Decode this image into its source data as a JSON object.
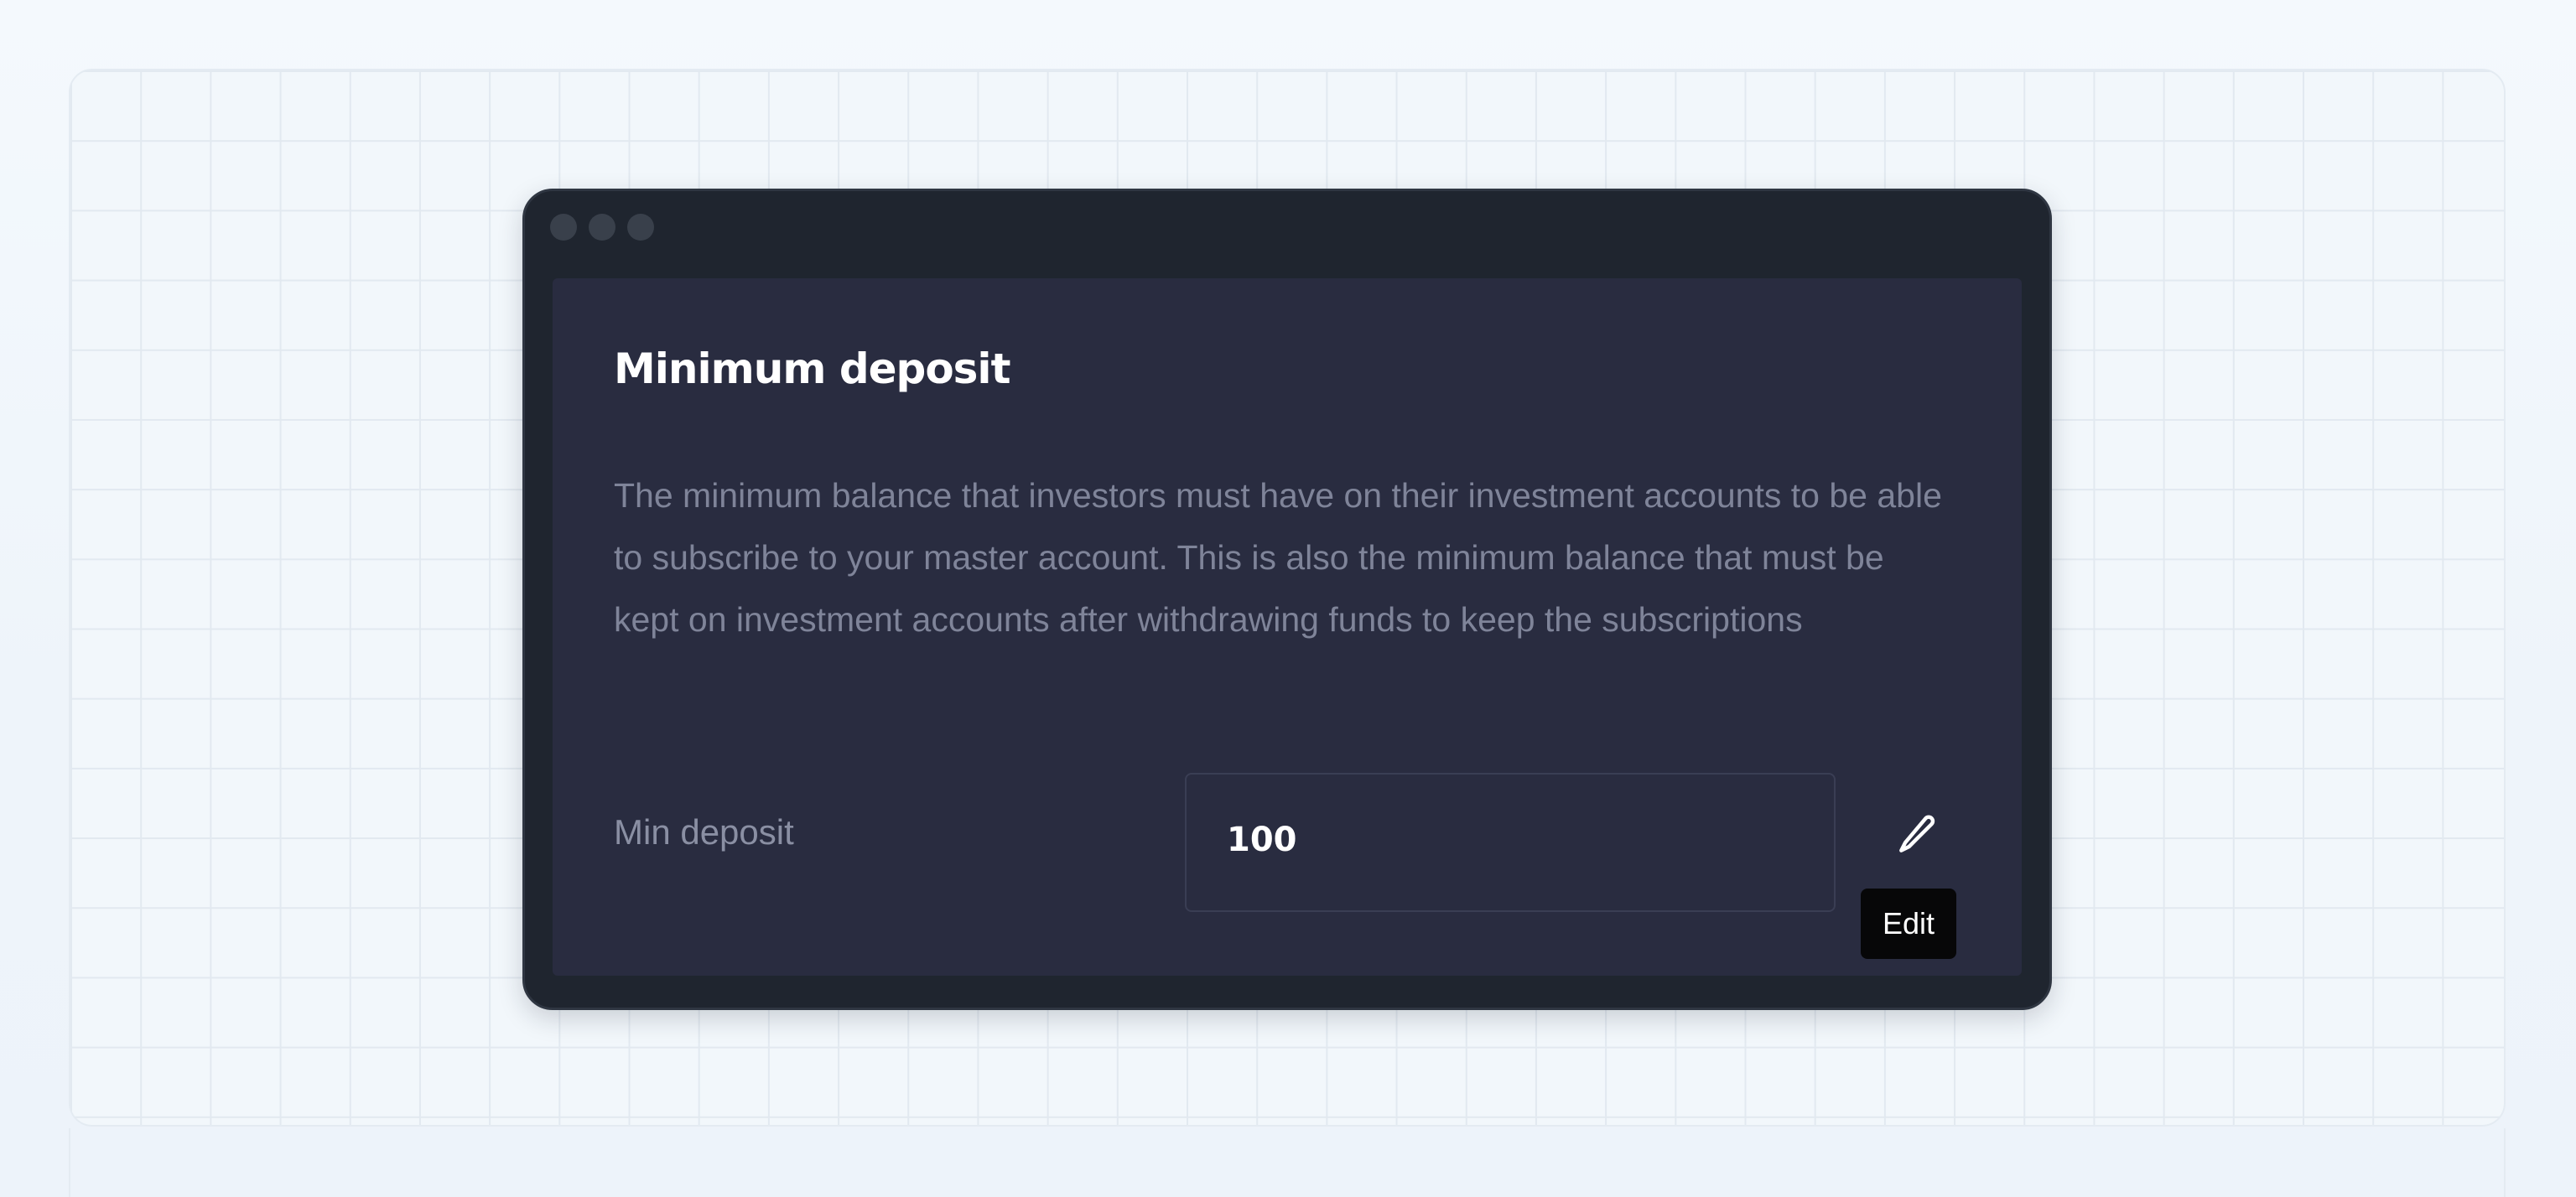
{
  "card": {
    "title": "Minimum deposit",
    "description": "The minimum balance that investors must have on their investment accounts to be able to subscribe to your master account. This is also the minimum balance that must be kept on investment accounts after withdrawing funds to keep the subscriptions"
  },
  "field": {
    "label": "Min deposit",
    "value": "100"
  },
  "edit": {
    "icon": "pencil-icon",
    "tooltip": "Edit"
  },
  "colors": {
    "window_frame": "#1f252f",
    "card_background": "#292c40",
    "title": "#ffffff",
    "muted_text": "#7f8499",
    "tooltip_background": "#070708"
  }
}
